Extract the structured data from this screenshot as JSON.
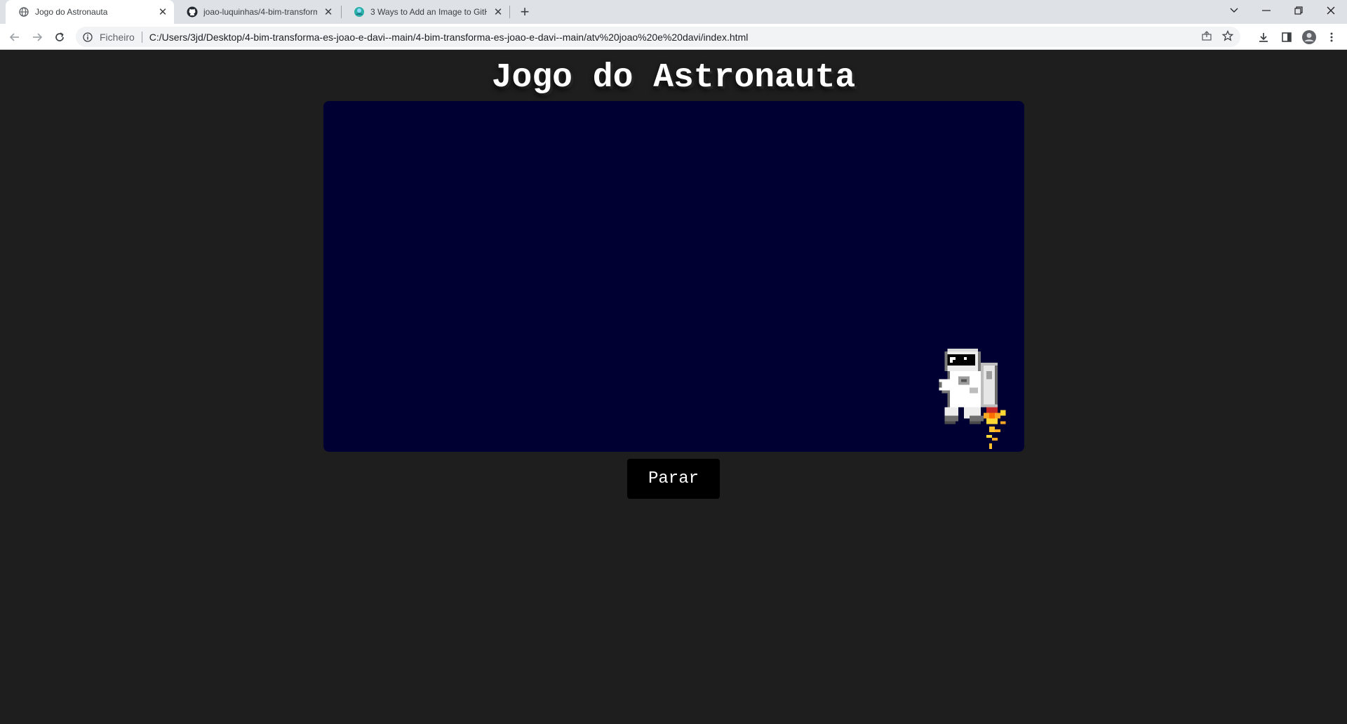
{
  "browser": {
    "tabs": [
      {
        "title": "Jogo do Astronauta",
        "icon": "globe-icon",
        "active": true
      },
      {
        "title": "joao-luquinhas/4-bim-transform",
        "icon": "github-icon",
        "active": false
      },
      {
        "title": "3 Ways to Add an Image to GitH",
        "icon": "site-favicon",
        "active": false
      }
    ],
    "address": {
      "chip": "Ficheiro",
      "url": "C:/Users/3jd/Desktop/4-bim-transforma-es-joao-e-davi--main/4-bim-transforma-es-joao-e-davi--main/atv%20joao%20e%20davi/index.html"
    }
  },
  "page": {
    "title": "Jogo do Astronauta",
    "stop_button_label": "Parar"
  },
  "colors": {
    "page_background": "#1e1e1e",
    "game_background": "#000033",
    "button_background": "#000000",
    "title_color": "#ffffff"
  }
}
